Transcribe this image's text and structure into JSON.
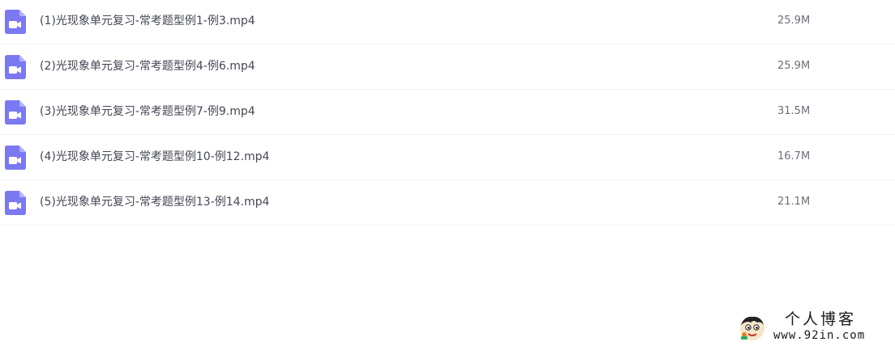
{
  "files": [
    {
      "name": "(1)光现象单元复习-常考题型例1-例3.mp4",
      "size": "25.9M",
      "icon": "video-file-icon"
    },
    {
      "name": "(2)光现象单元复习-常考题型例4-例6.mp4",
      "size": "25.9M",
      "icon": "video-file-icon"
    },
    {
      "name": "(3)光现象单元复习-常考题型例7-例9.mp4",
      "size": "31.5M",
      "icon": "video-file-icon"
    },
    {
      "name": "(4)光现象单元复习-常考题型例10-例12.mp4",
      "size": "16.7M",
      "icon": "video-file-icon"
    },
    {
      "name": "(5)光现象单元复习-常考题型例13-例14.mp4",
      "size": "21.1M",
      "icon": "video-file-icon"
    }
  ],
  "watermark": {
    "title": "个人博客",
    "url": "www.92in.com"
  },
  "colors": {
    "icon_color": "#7b79f2",
    "text": "#444754",
    "size_text": "#6b6f7a",
    "divider": "#f0f0f2"
  }
}
